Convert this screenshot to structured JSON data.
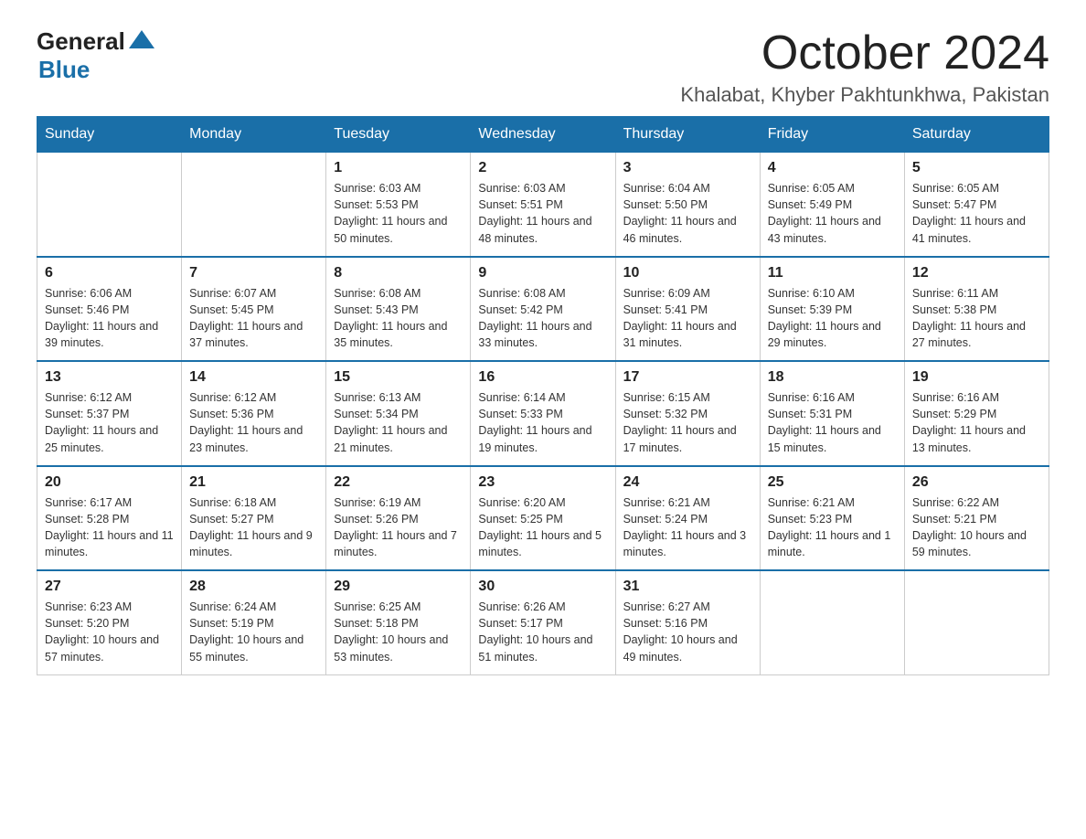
{
  "header": {
    "logo_general": "General",
    "logo_blue": "Blue",
    "title": "October 2024",
    "subtitle": "Khalabat, Khyber Pakhtunkhwa, Pakistan"
  },
  "weekdays": [
    "Sunday",
    "Monday",
    "Tuesday",
    "Wednesday",
    "Thursday",
    "Friday",
    "Saturday"
  ],
  "weeks": [
    [
      {
        "day": "",
        "sunrise": "",
        "sunset": "",
        "daylight": ""
      },
      {
        "day": "",
        "sunrise": "",
        "sunset": "",
        "daylight": ""
      },
      {
        "day": "1",
        "sunrise": "Sunrise: 6:03 AM",
        "sunset": "Sunset: 5:53 PM",
        "daylight": "Daylight: 11 hours and 50 minutes."
      },
      {
        "day": "2",
        "sunrise": "Sunrise: 6:03 AM",
        "sunset": "Sunset: 5:51 PM",
        "daylight": "Daylight: 11 hours and 48 minutes."
      },
      {
        "day": "3",
        "sunrise": "Sunrise: 6:04 AM",
        "sunset": "Sunset: 5:50 PM",
        "daylight": "Daylight: 11 hours and 46 minutes."
      },
      {
        "day": "4",
        "sunrise": "Sunrise: 6:05 AM",
        "sunset": "Sunset: 5:49 PM",
        "daylight": "Daylight: 11 hours and 43 minutes."
      },
      {
        "day": "5",
        "sunrise": "Sunrise: 6:05 AM",
        "sunset": "Sunset: 5:47 PM",
        "daylight": "Daylight: 11 hours and 41 minutes."
      }
    ],
    [
      {
        "day": "6",
        "sunrise": "Sunrise: 6:06 AM",
        "sunset": "Sunset: 5:46 PM",
        "daylight": "Daylight: 11 hours and 39 minutes."
      },
      {
        "day": "7",
        "sunrise": "Sunrise: 6:07 AM",
        "sunset": "Sunset: 5:45 PM",
        "daylight": "Daylight: 11 hours and 37 minutes."
      },
      {
        "day": "8",
        "sunrise": "Sunrise: 6:08 AM",
        "sunset": "Sunset: 5:43 PM",
        "daylight": "Daylight: 11 hours and 35 minutes."
      },
      {
        "day": "9",
        "sunrise": "Sunrise: 6:08 AM",
        "sunset": "Sunset: 5:42 PM",
        "daylight": "Daylight: 11 hours and 33 minutes."
      },
      {
        "day": "10",
        "sunrise": "Sunrise: 6:09 AM",
        "sunset": "Sunset: 5:41 PM",
        "daylight": "Daylight: 11 hours and 31 minutes."
      },
      {
        "day": "11",
        "sunrise": "Sunrise: 6:10 AM",
        "sunset": "Sunset: 5:39 PM",
        "daylight": "Daylight: 11 hours and 29 minutes."
      },
      {
        "day": "12",
        "sunrise": "Sunrise: 6:11 AM",
        "sunset": "Sunset: 5:38 PM",
        "daylight": "Daylight: 11 hours and 27 minutes."
      }
    ],
    [
      {
        "day": "13",
        "sunrise": "Sunrise: 6:12 AM",
        "sunset": "Sunset: 5:37 PM",
        "daylight": "Daylight: 11 hours and 25 minutes."
      },
      {
        "day": "14",
        "sunrise": "Sunrise: 6:12 AM",
        "sunset": "Sunset: 5:36 PM",
        "daylight": "Daylight: 11 hours and 23 minutes."
      },
      {
        "day": "15",
        "sunrise": "Sunrise: 6:13 AM",
        "sunset": "Sunset: 5:34 PM",
        "daylight": "Daylight: 11 hours and 21 minutes."
      },
      {
        "day": "16",
        "sunrise": "Sunrise: 6:14 AM",
        "sunset": "Sunset: 5:33 PM",
        "daylight": "Daylight: 11 hours and 19 minutes."
      },
      {
        "day": "17",
        "sunrise": "Sunrise: 6:15 AM",
        "sunset": "Sunset: 5:32 PM",
        "daylight": "Daylight: 11 hours and 17 minutes."
      },
      {
        "day": "18",
        "sunrise": "Sunrise: 6:16 AM",
        "sunset": "Sunset: 5:31 PM",
        "daylight": "Daylight: 11 hours and 15 minutes."
      },
      {
        "day": "19",
        "sunrise": "Sunrise: 6:16 AM",
        "sunset": "Sunset: 5:29 PM",
        "daylight": "Daylight: 11 hours and 13 minutes."
      }
    ],
    [
      {
        "day": "20",
        "sunrise": "Sunrise: 6:17 AM",
        "sunset": "Sunset: 5:28 PM",
        "daylight": "Daylight: 11 hours and 11 minutes."
      },
      {
        "day": "21",
        "sunrise": "Sunrise: 6:18 AM",
        "sunset": "Sunset: 5:27 PM",
        "daylight": "Daylight: 11 hours and 9 minutes."
      },
      {
        "day": "22",
        "sunrise": "Sunrise: 6:19 AM",
        "sunset": "Sunset: 5:26 PM",
        "daylight": "Daylight: 11 hours and 7 minutes."
      },
      {
        "day": "23",
        "sunrise": "Sunrise: 6:20 AM",
        "sunset": "Sunset: 5:25 PM",
        "daylight": "Daylight: 11 hours and 5 minutes."
      },
      {
        "day": "24",
        "sunrise": "Sunrise: 6:21 AM",
        "sunset": "Sunset: 5:24 PM",
        "daylight": "Daylight: 11 hours and 3 minutes."
      },
      {
        "day": "25",
        "sunrise": "Sunrise: 6:21 AM",
        "sunset": "Sunset: 5:23 PM",
        "daylight": "Daylight: 11 hours and 1 minute."
      },
      {
        "day": "26",
        "sunrise": "Sunrise: 6:22 AM",
        "sunset": "Sunset: 5:21 PM",
        "daylight": "Daylight: 10 hours and 59 minutes."
      }
    ],
    [
      {
        "day": "27",
        "sunrise": "Sunrise: 6:23 AM",
        "sunset": "Sunset: 5:20 PM",
        "daylight": "Daylight: 10 hours and 57 minutes."
      },
      {
        "day": "28",
        "sunrise": "Sunrise: 6:24 AM",
        "sunset": "Sunset: 5:19 PM",
        "daylight": "Daylight: 10 hours and 55 minutes."
      },
      {
        "day": "29",
        "sunrise": "Sunrise: 6:25 AM",
        "sunset": "Sunset: 5:18 PM",
        "daylight": "Daylight: 10 hours and 53 minutes."
      },
      {
        "day": "30",
        "sunrise": "Sunrise: 6:26 AM",
        "sunset": "Sunset: 5:17 PM",
        "daylight": "Daylight: 10 hours and 51 minutes."
      },
      {
        "day": "31",
        "sunrise": "Sunrise: 6:27 AM",
        "sunset": "Sunset: 5:16 PM",
        "daylight": "Daylight: 10 hours and 49 minutes."
      },
      {
        "day": "",
        "sunrise": "",
        "sunset": "",
        "daylight": ""
      },
      {
        "day": "",
        "sunrise": "",
        "sunset": "",
        "daylight": ""
      }
    ]
  ]
}
